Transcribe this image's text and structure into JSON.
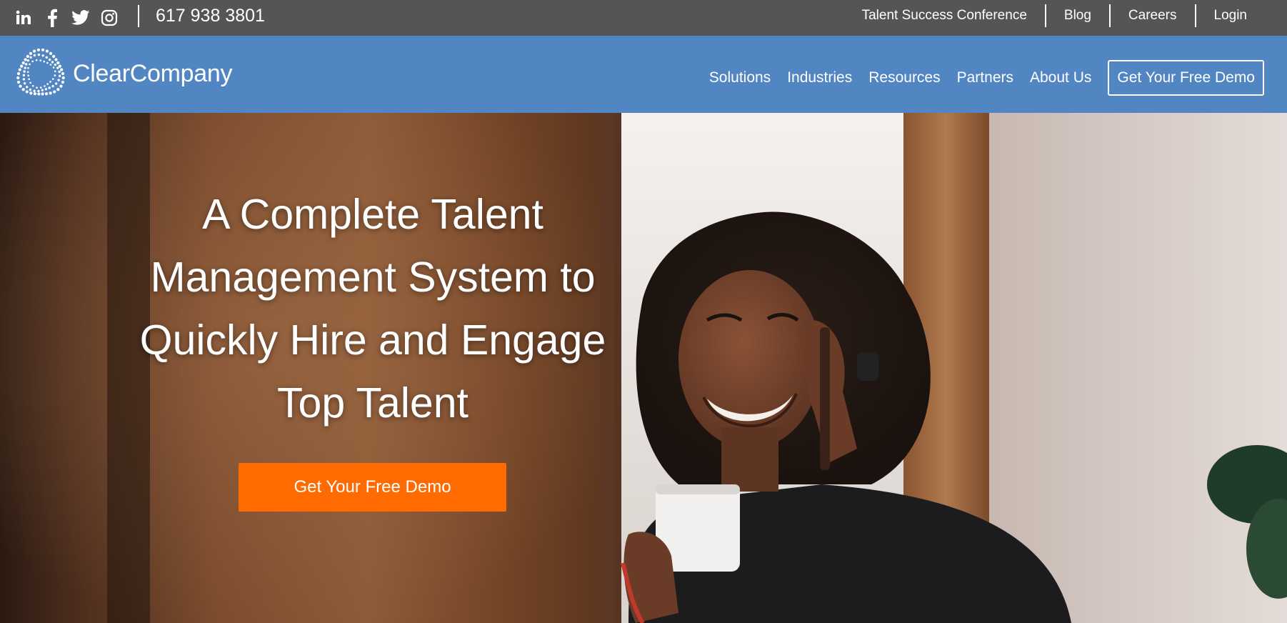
{
  "utility_bar": {
    "social": [
      {
        "icon": "linkedin-icon"
      },
      {
        "icon": "facebook-icon"
      },
      {
        "icon": "twitter-icon"
      },
      {
        "icon": "instagram-icon"
      }
    ],
    "phone": "617 938 3801",
    "links": [
      "Talent Success Conference",
      "Blog",
      "Careers",
      "Login"
    ]
  },
  "nav": {
    "logo_text": "ClearCompany",
    "items": [
      "Solutions",
      "Industries",
      "Resources",
      "Partners",
      "About Us"
    ],
    "cta_label": "Get Your Free Demo"
  },
  "hero": {
    "headline_lines": [
      "A Complete Talent",
      "Management System to",
      "Quickly Hire and Engage",
      "Top Talent"
    ],
    "cta_label": "Get Your Free Demo"
  },
  "colors": {
    "utility_bar_bg": "#555555",
    "nav_bg": "#5286c2",
    "cta_orange": "#ff6b00",
    "text_white": "#ffffff"
  }
}
